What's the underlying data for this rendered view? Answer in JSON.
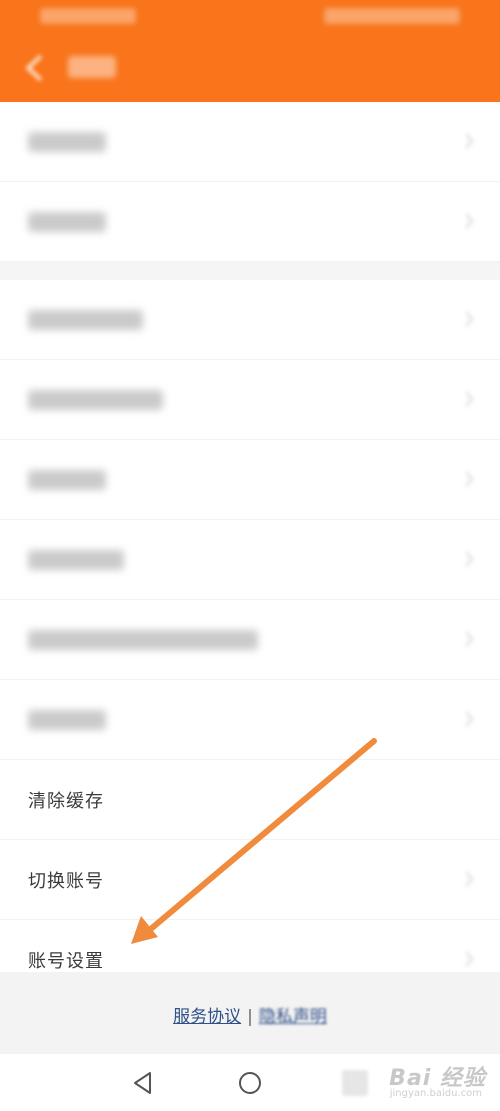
{
  "header": {
    "background": "#f9741a",
    "back_icon": "back-arrow-icon"
  },
  "list": {
    "items": [
      {
        "label": "",
        "visible": false,
        "blur_width": 78
      },
      {
        "label": "",
        "visible": false,
        "blur_width": 78
      },
      {
        "label": "",
        "visible": false,
        "blur_width": 115
      },
      {
        "label": "",
        "visible": false,
        "blur_width": 135
      },
      {
        "label": "",
        "visible": false,
        "blur_width": 78
      },
      {
        "label": "",
        "visible": false,
        "blur_width": 96
      },
      {
        "label": "",
        "visible": false,
        "blur_width": 230
      },
      {
        "label": "",
        "visible": false,
        "blur_width": 78
      },
      {
        "label": "清除缓存",
        "visible": true
      },
      {
        "label": "切换账号",
        "visible": true
      },
      {
        "label": "账号设置",
        "visible": true
      }
    ]
  },
  "footer": {
    "service_agreement": "服务协议",
    "separator": "|",
    "privacy_statement": "隐私声明"
  },
  "sysnav": {
    "back_icon": "triangle-back-icon",
    "home_icon": "circle-home-icon",
    "recent_icon": "square-recent-icon"
  },
  "watermark": {
    "brand": "Bai 经验",
    "sub": "jingyan.baidu.com"
  },
  "annotation": {
    "color": "#f08a3c"
  }
}
